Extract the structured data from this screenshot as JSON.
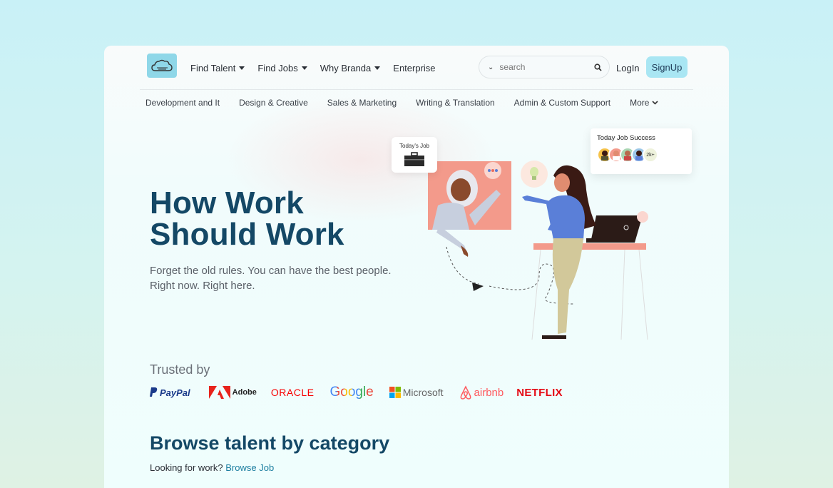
{
  "header": {
    "nav": [
      "Find Talent",
      "Find Jobs",
      "Why Branda",
      "Enterprise"
    ],
    "search_placeholder": "search",
    "login": "LogIn",
    "signup": "SignUp"
  },
  "categories": [
    "Development and It",
    "Design & Creative",
    "Sales & Marketing",
    "Writing & Translation",
    "Admin & Custom Support",
    "More"
  ],
  "hero": {
    "title_line1": "How Work",
    "title_line2": "Should Work",
    "subtitle_line1": "Forget the old rules. You can have the best people.",
    "subtitle_line2": "Right now. Right here."
  },
  "illustration": {
    "today_job_label": "Today's Job",
    "success_label": "Today Job Success",
    "success_count": "2k+"
  },
  "trusted": {
    "label": "Trusted by",
    "brands": [
      "PayPal",
      "Adobe",
      "ORACLE",
      "Google",
      "Microsoft",
      "airbnb",
      "NETFLIX"
    ]
  },
  "browse": {
    "title": "Browse talent by category",
    "looking": "Looking for work?",
    "link": "Browse Job"
  },
  "colors": {
    "accent": "#144866",
    "signup_bg": "#a9e6f3",
    "netflix": "#e50914",
    "oracle": "#f80000",
    "link": "#1c7fa0"
  }
}
